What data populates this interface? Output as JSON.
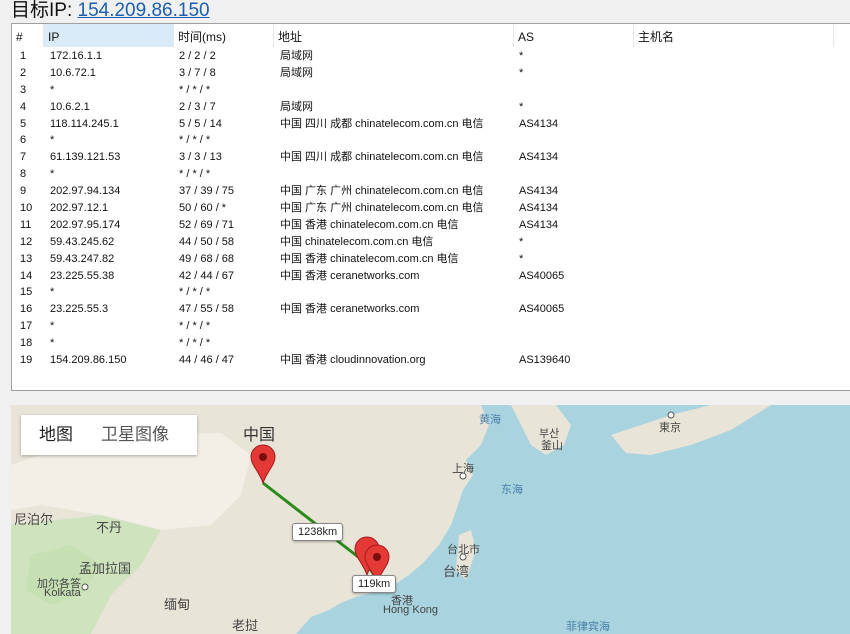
{
  "header": {
    "prefix": "目标IP:",
    "ip": "154.209.86.150"
  },
  "table": {
    "columns": [
      "#",
      "IP",
      "时间(ms)",
      "地址",
      "AS",
      "主机名"
    ],
    "rows": [
      [
        "1",
        "172.16.1.1",
        "2 / 2 / 2",
        "局域网",
        "*",
        ""
      ],
      [
        "2",
        "10.6.72.1",
        "3 / 7 / 8",
        "局域网",
        "*",
        ""
      ],
      [
        "3",
        "*",
        "* / * / *",
        "",
        "",
        ""
      ],
      [
        "4",
        "10.6.2.1",
        "2 / 3 / 7",
        "局域网",
        "*",
        ""
      ],
      [
        "5",
        "118.114.245.1",
        "5 / 5 / 14",
        "中国 四川 成都 chinatelecom.com.cn 电信",
        "AS4134",
        ""
      ],
      [
        "6",
        "*",
        "* / * / *",
        "",
        "",
        ""
      ],
      [
        "7",
        "61.139.121.53",
        "3 / 3 / 13",
        "中国 四川 成都 chinatelecom.com.cn 电信",
        "AS4134",
        ""
      ],
      [
        "8",
        "*",
        "* / * / *",
        "",
        "",
        ""
      ],
      [
        "9",
        "202.97.94.134",
        "37 / 39 / 75",
        "中国 广东 广州 chinatelecom.com.cn 电信",
        "AS4134",
        ""
      ],
      [
        "10",
        "202.97.12.1",
        "50 / 60 / *",
        "中国 广东 广州 chinatelecom.com.cn 电信",
        "AS4134",
        ""
      ],
      [
        "11",
        "202.97.95.174",
        "52 / 69 / 71",
        "中国 香港 chinatelecom.com.cn 电信",
        "AS4134",
        ""
      ],
      [
        "12",
        "59.43.245.62",
        "44 / 50 / 58",
        "中国 chinatelecom.com.cn 电信",
        "*",
        ""
      ],
      [
        "13",
        "59.43.247.82",
        "49 / 68 / 68",
        "中国 香港 chinatelecom.com.cn 电信",
        "*",
        ""
      ],
      [
        "14",
        "23.225.55.38",
        "42 / 44 / 67",
        "中国 香港 ceranetworks.com",
        "AS40065",
        ""
      ],
      [
        "15",
        "*",
        "* / * / *",
        "",
        "",
        ""
      ],
      [
        "16",
        "23.225.55.3",
        "47 / 55 / 58",
        "中国 香港 ceranetworks.com",
        "AS40065",
        ""
      ],
      [
        "17",
        "*",
        "* / * / *",
        "",
        "",
        ""
      ],
      [
        "18",
        "*",
        "* / * / *",
        "",
        "",
        ""
      ],
      [
        "19",
        "154.209.86.150",
        "44 / 46 / 47",
        "中国 香港 cloudinnovation.org",
        "AS139640",
        ""
      ]
    ]
  },
  "map": {
    "toggle": {
      "map": "地图",
      "satellite": "卫星图像"
    },
    "labels": {
      "china": "中国",
      "yellow_sea": "黄海",
      "east_sea": "东海",
      "busan": "釜山",
      "busan_kr": "부산",
      "tokyo": "東京",
      "shanghai": "上海",
      "taipei": "台北市",
      "taiwan": "台湾",
      "nepal": "尼泊尔",
      "bhutan": "不丹",
      "bangladesh": "孟加拉国",
      "kolkata_cn": "加尔各答",
      "kolkata": "Kolkata",
      "myanmar": "缅甸",
      "laos": "老挝",
      "hk_cn": "香港",
      "hk": "Hong Kong",
      "philippine_sea": "菲律宾海"
    },
    "distances": {
      "leg1": "1238km",
      "leg2": "119km"
    },
    "colors": {
      "route": "#2a8a1a",
      "marker": "#e53935"
    }
  }
}
